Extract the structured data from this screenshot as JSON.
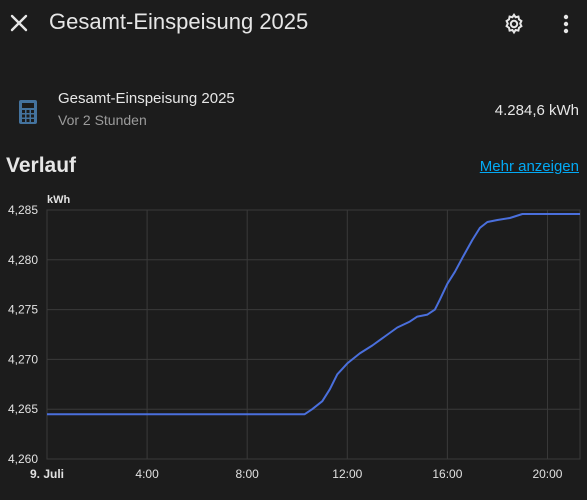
{
  "header": {
    "title": "Gesamt-Einspeisung 2025",
    "close_icon": "close-icon",
    "settings_icon": "gear-icon",
    "menu_icon": "more-vertical-icon"
  },
  "entity": {
    "icon": "calculator-icon",
    "name": "Gesamt-Einspeisung 2025",
    "last_changed": "Vor 2 Stunden",
    "state": "4.284,6 kWh"
  },
  "history": {
    "title": "Verlauf",
    "more_link": "Mehr anzeigen"
  },
  "colors": {
    "background": "#1c1c1c",
    "accent_link": "#03a9f4",
    "series": "#4a6fdc",
    "icon": "#44739e"
  },
  "chart_data": {
    "type": "line",
    "unit_label": "kWh",
    "x_hours_range": [
      0,
      21.3
    ],
    "ylim": [
      4260,
      4285
    ],
    "y_ticks": [
      4260,
      4265,
      4270,
      4275,
      4280,
      4285
    ],
    "y_tick_labels": [
      "4,260",
      "4,265",
      "4,270",
      "4,275",
      "4,280",
      "4,285"
    ],
    "x_ticks": [
      {
        "hour": 0,
        "label": "9. Juli",
        "bold": true
      },
      {
        "hour": 4,
        "label": "4:00",
        "bold": false
      },
      {
        "hour": 8,
        "label": "8:00",
        "bold": false
      },
      {
        "hour": 12,
        "label": "12:00",
        "bold": false
      },
      {
        "hour": 16,
        "label": "16:00",
        "bold": false
      },
      {
        "hour": 20,
        "label": "20:00",
        "bold": false
      }
    ],
    "series": [
      {
        "color": "#4a6fdc",
        "points": [
          [
            -1.6,
            4264.5
          ],
          [
            10.3,
            4264.5
          ],
          [
            10.6,
            4265.0
          ],
          [
            11.0,
            4265.8
          ],
          [
            11.3,
            4267.0
          ],
          [
            11.6,
            4268.5
          ],
          [
            12.0,
            4269.6
          ],
          [
            12.5,
            4270.6
          ],
          [
            13.0,
            4271.4
          ],
          [
            13.5,
            4272.3
          ],
          [
            14.0,
            4273.2
          ],
          [
            14.5,
            4273.8
          ],
          [
            14.8,
            4274.3
          ],
          [
            15.2,
            4274.5
          ],
          [
            15.5,
            4275.0
          ],
          [
            15.7,
            4276.0
          ],
          [
            16.0,
            4277.6
          ],
          [
            16.3,
            4278.8
          ],
          [
            16.6,
            4280.2
          ],
          [
            17.0,
            4282.0
          ],
          [
            17.3,
            4283.2
          ],
          [
            17.6,
            4283.8
          ],
          [
            18.0,
            4284.0
          ],
          [
            18.5,
            4284.2
          ],
          [
            19.0,
            4284.6
          ],
          [
            21.3,
            4284.6
          ]
        ]
      }
    ]
  }
}
